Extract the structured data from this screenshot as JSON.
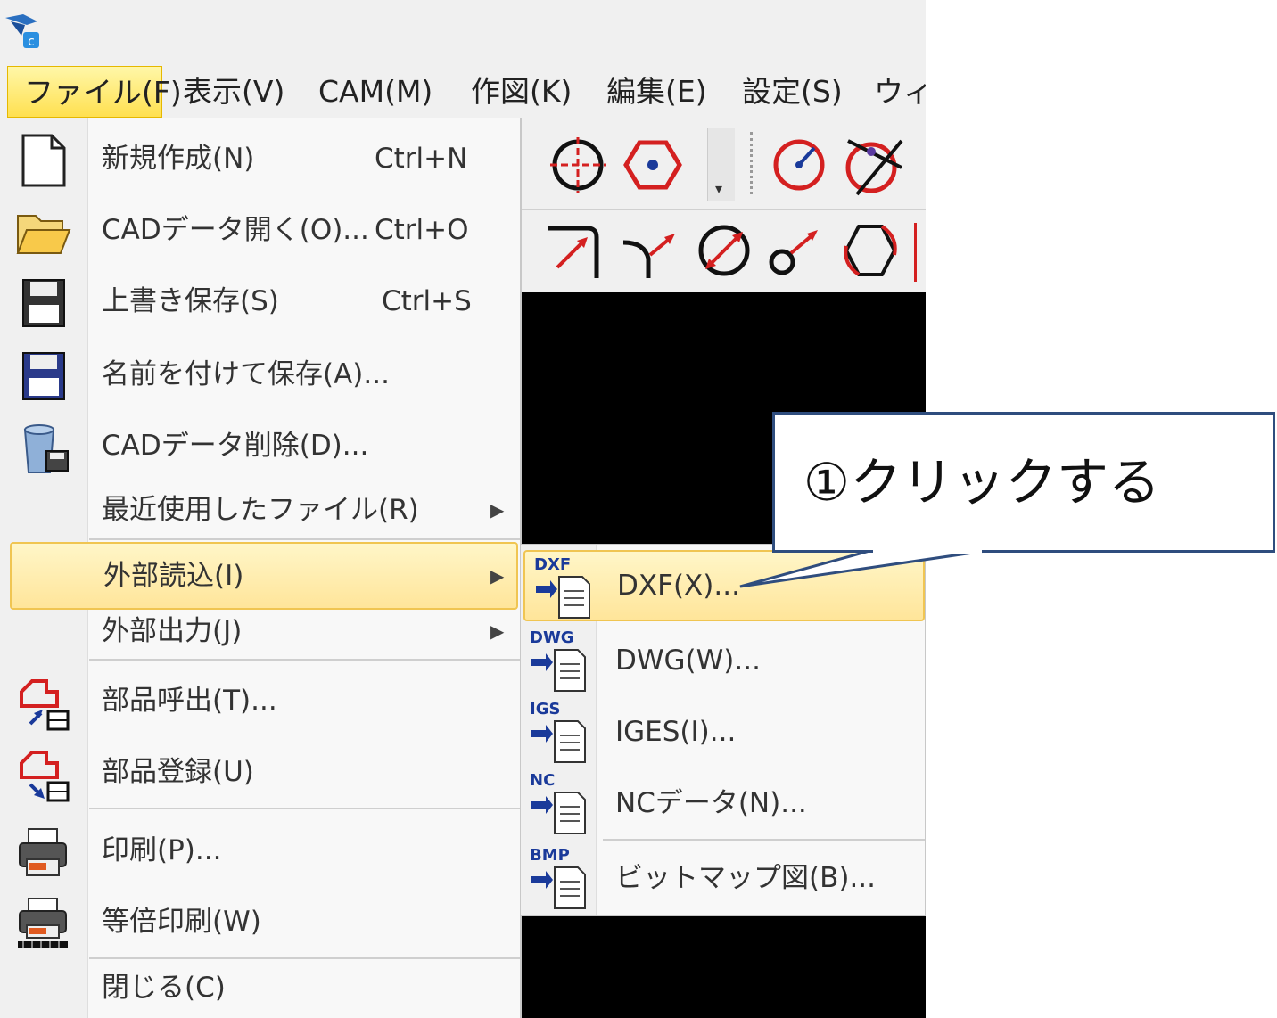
{
  "menubar": {
    "items": [
      {
        "label": "ファイル(F)",
        "active": true
      },
      {
        "label": "表示(V)"
      },
      {
        "label": "CAM(M)"
      },
      {
        "label": "作図(K)"
      },
      {
        "label": "編集(E)"
      },
      {
        "label": "設定(S)"
      },
      {
        "label": "ウィン"
      }
    ]
  },
  "file_menu": {
    "items": [
      {
        "label": "新規作成(N)",
        "shortcut": "Ctrl+N",
        "icon": "new-document-icon"
      },
      {
        "label": "CADデータ開く(O)...",
        "shortcut": "Ctrl+O",
        "icon": "open-folder-icon"
      },
      {
        "label": "上書き保存(S)",
        "shortcut": "Ctrl+S",
        "icon": "save-disk-icon"
      },
      {
        "label": "名前を付けて保存(A)...",
        "shortcut": "",
        "icon": "save-as-disk-icon"
      },
      {
        "label": "CADデータ削除(D)...",
        "shortcut": "",
        "icon": "delete-data-icon"
      },
      {
        "label": "最近使用したファイル(R)",
        "shortcut": "",
        "submenu": true
      },
      {
        "label": "外部読込(I)",
        "shortcut": "",
        "submenu": true,
        "highlighted": true
      },
      {
        "label": "外部出力(J)",
        "shortcut": "",
        "submenu": true
      },
      {
        "label": "部品呼出(T)...",
        "shortcut": "",
        "icon": "part-load-icon"
      },
      {
        "label": "部品登録(U)",
        "shortcut": "",
        "icon": "part-register-icon"
      },
      {
        "label": "印刷(P)...",
        "shortcut": "",
        "icon": "printer-icon"
      },
      {
        "label": "等倍印刷(W)",
        "shortcut": "",
        "icon": "actual-size-print-icon"
      },
      {
        "label": "閉じる(C)",
        "shortcut": ""
      }
    ]
  },
  "import_submenu": {
    "items": [
      {
        "label": "DXF(X)...",
        "badge": "DXF",
        "highlighted": true
      },
      {
        "label": "DWG(W)...",
        "badge": "DWG"
      },
      {
        "label": "IGES(I)...",
        "badge": "IGS"
      },
      {
        "label": "NCデータ(N)...",
        "badge": "NC"
      },
      {
        "label": "ビットマップ図(B)...",
        "badge": "BMP"
      }
    ]
  },
  "callout": {
    "text": "①クリックする"
  },
  "colors": {
    "highlight": "#ffe59a",
    "highlight_border": "#f0c552",
    "callout_border": "#2f4d7e",
    "canvas": "#000000",
    "icon_red": "#d42020",
    "icon_blue": "#1a3a9a"
  }
}
